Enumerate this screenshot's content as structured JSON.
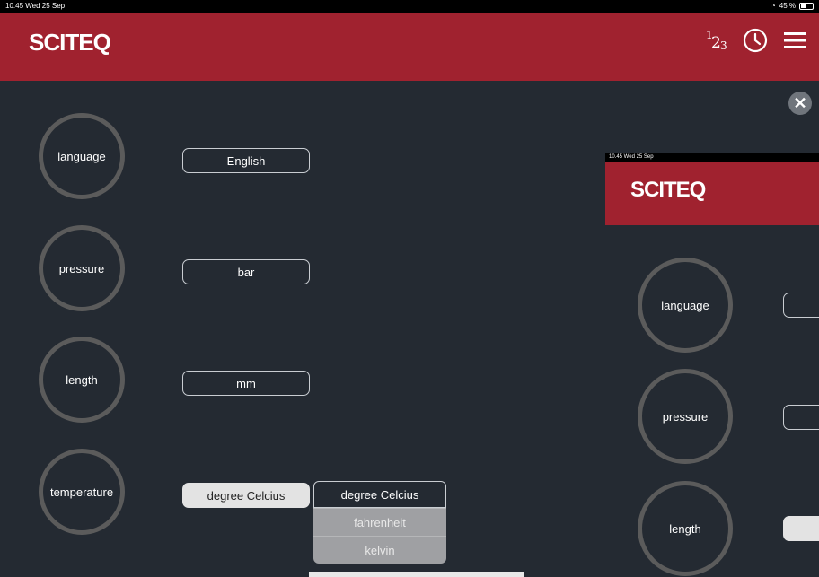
{
  "status": {
    "time": "10.45 Wed 25 Sep",
    "battery": "45 %"
  },
  "header": {
    "brand": "SCITEQ"
  },
  "icons": {
    "numbering": "numbering-icon",
    "history": "clock-icon",
    "menu": "hamburger-menu-icon",
    "close": "close-icon"
  },
  "close": {
    "label": "✕"
  },
  "settings": [
    {
      "label": "language",
      "value": "English"
    },
    {
      "label": "pressure",
      "value": "bar"
    },
    {
      "label": "length",
      "value": "mm"
    },
    {
      "label": "temperature",
      "value": "degree Celcius"
    }
  ],
  "dropdown": {
    "options": [
      "degree Celcius",
      "fahrenheit",
      "kelvin"
    ]
  },
  "preview": {
    "status_time": "10.45 Wed 25 Sep",
    "brand": "SCITEQ",
    "labels": [
      "language",
      "pressure",
      "length"
    ]
  },
  "colors": {
    "header": "#a0222f",
    "background": "#242a32",
    "circle_border": "#5b5b5b"
  }
}
